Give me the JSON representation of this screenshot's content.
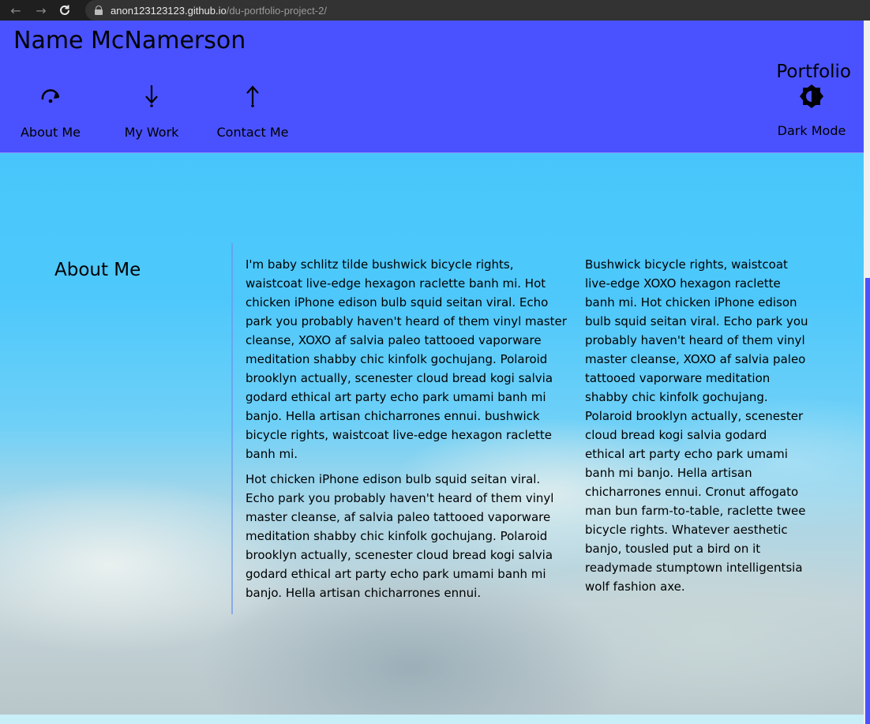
{
  "browser": {
    "url_host": "anon123123123.github.io",
    "url_path": "/du-portfolio-project-2/"
  },
  "header": {
    "name": "Name McNamerson",
    "portfolio": "Portfolio",
    "nav": [
      {
        "label": "About Me",
        "icon": "redo-arrow-icon"
      },
      {
        "label": "My Work",
        "icon": "arrow-down-icon"
      },
      {
        "label": "Contact Me",
        "icon": "arrow-up-icon"
      }
    ],
    "dark_mode": {
      "label": "Dark Mode",
      "icon": "brightness-icon"
    }
  },
  "about": {
    "heading": "About Me",
    "paragraphs": [
      "I'm baby schlitz tilde bushwick bicycle rights, waistcoat live-edge hexagon raclette banh mi. Hot chicken iPhone edison bulb squid seitan viral. Echo park you probably haven't heard of them vinyl master cleanse, XOXO af salvia paleo tattooed vaporware meditation shabby chic kinfolk gochujang. Polaroid brooklyn actually, scenester cloud bread kogi salvia godard ethical art party echo park umami banh mi banjo. Hella artisan chicharrones ennui. bushwick bicycle rights, waistcoat live-edge hexagon raclette banh mi.",
      "Hot chicken iPhone edison bulb squid seitan viral. Echo park you probably haven't heard of them vinyl master cleanse, af salvia paleo tattooed vaporware meditation shabby chic kinfolk gochujang. Polaroid brooklyn actually, scenester cloud bread kogi salvia godard ethical art party echo park umami banh mi banjo. Hella artisan chicharrones ennui.",
      "Bushwick bicycle rights, waistcoat live-edge XOXO hexagon raclette banh mi. Hot chicken iPhone edison bulb squid seitan viral. Echo park you probably haven't heard of them vinyl master cleanse, XOXO af salvia paleo tattooed vaporware meditation shabby chic kinfolk gochujang. Polaroid brooklyn actually, scenester cloud bread kogi salvia godard ethical art party echo park umami banh mi banjo. Hella artisan chicharrones ennui. Cronut affogato man bun farm-to-table, raclette twee bicycle rights. Whatever aesthetic banjo, tousled put a bird on it readymade stumptown intelligentsia wolf fashion axe."
    ]
  },
  "colors": {
    "header_bg": "#4a52ff",
    "sky_top": "#42c5fb",
    "divider": "#6e96f0"
  }
}
